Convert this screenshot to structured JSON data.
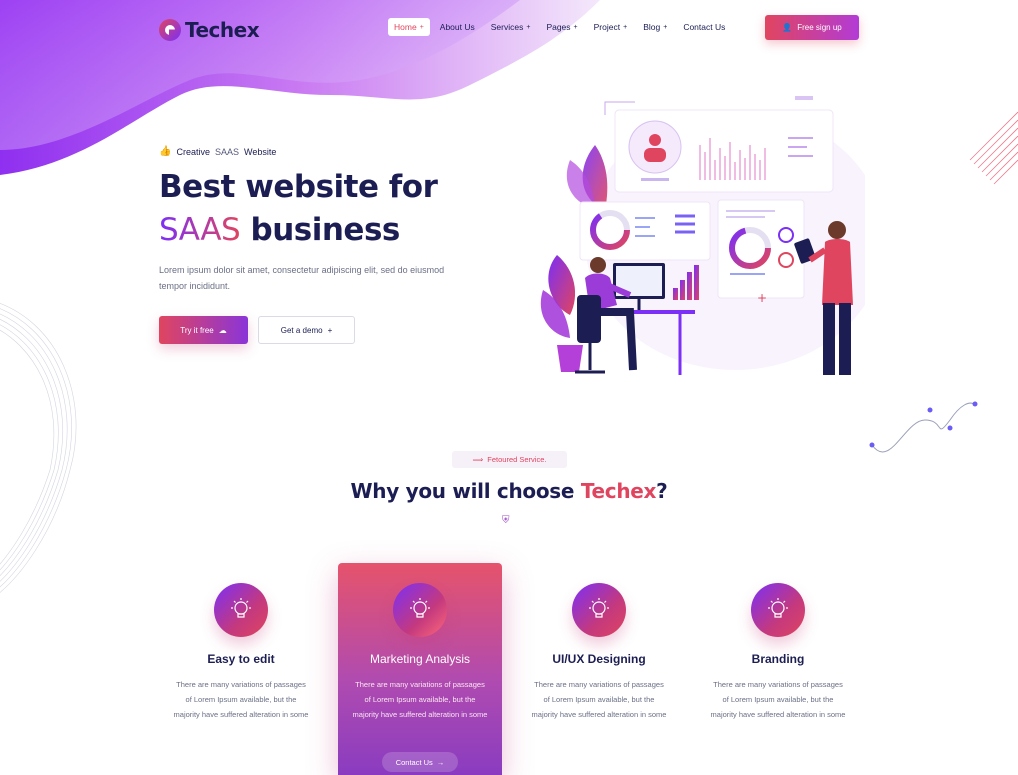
{
  "brand": {
    "name": "Techex"
  },
  "nav": {
    "items": [
      {
        "label": "Home",
        "suffix": "+"
      },
      {
        "label": "About Us",
        "suffix": ""
      },
      {
        "label": "Services",
        "suffix": "+"
      },
      {
        "label": "Pages",
        "suffix": "+"
      },
      {
        "label": "Project",
        "suffix": "+"
      },
      {
        "label": "Blog",
        "suffix": "+"
      },
      {
        "label": "Contact Us",
        "suffix": ""
      }
    ],
    "signup_label": "Free sign up",
    "signup_icon": "user-plus-icon"
  },
  "hero": {
    "badge_prefix": "Creative",
    "badge_middle": "SAAS",
    "badge_suffix": "Website",
    "badge_icon": "thumbs-up-icon",
    "title_line1": "Best website for",
    "title_accent": "SAAS",
    "title_line2_rest": "business",
    "description": "Lorem ipsum dolor sit amet, consectetur adipiscing elit, sed do eiusmod tempor incididunt.",
    "try_label": "Try it free",
    "try_icon": "cloud-download-icon",
    "demo_label": "Get a demo",
    "demo_icon": "plus-icon"
  },
  "section": {
    "tag_icon": "double-arrow-icon",
    "tag_label": "Fetoured Service.",
    "title_main": "Why you will choose",
    "title_accent": "Techex",
    "title_end": "?",
    "divider_icon": "shield-icon"
  },
  "cards": [
    {
      "title": "Easy to edit",
      "text": "There are many variations of passages of Lorem Ipsum available, but the majority have suffered alteration in some",
      "icon": "lightbulb-icon",
      "active": false
    },
    {
      "title": "Marketing Analysis",
      "text": "There are many variations of passages of Lorem Ipsum available, but the majority have suffered alteration in some",
      "icon": "lightbulb-icon",
      "active": true,
      "button_label": "Contact Us",
      "button_icon": "arrow-right-icon"
    },
    {
      "title": "UI/UX Designing",
      "text": "There are many variations of passages of Lorem Ipsum available, but the majority have suffered alteration in some",
      "icon": "lightbulb-icon",
      "active": false
    },
    {
      "title": "Branding",
      "text": "There are many variations of passages of Lorem Ipsum available, but the majority have suffered alteration in some",
      "icon": "lightbulb-icon",
      "active": false
    }
  ],
  "colors": {
    "primary_dark": "#1c1e53",
    "accent_red": "#e0455f",
    "accent_purple": "#7b2ff7"
  }
}
